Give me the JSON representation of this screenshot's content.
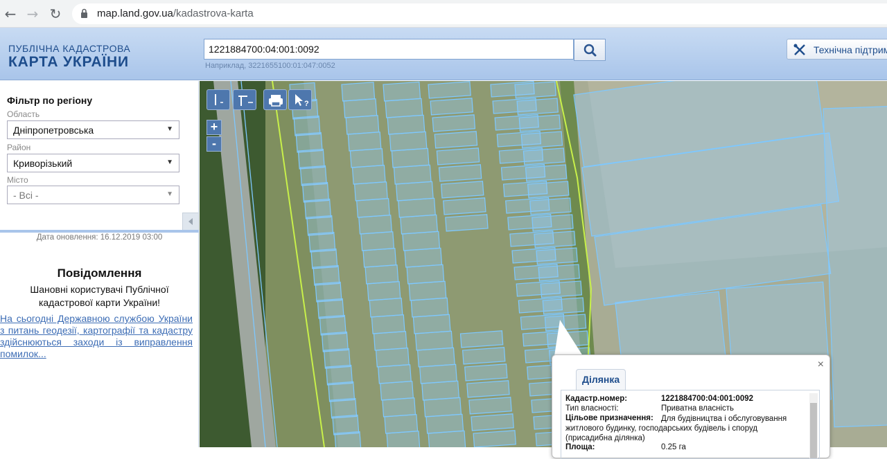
{
  "browser": {
    "url_host": "map.land.gov.ua",
    "url_path": "/kadastrova-karta",
    "back": "←",
    "forward": "→",
    "reload": "↻"
  },
  "header": {
    "logo_top": "ПУБЛІЧНА КАДАСТРОВА",
    "logo_bottom": "КАРТА УКРАЇНИ",
    "search_value": "1221884700:04:001:0092",
    "search_hint": "Наприклад, 3221655100:01:047:0052",
    "support_label": "Технічна підтримка"
  },
  "sidebar": {
    "filter_title": "Фільтр по регіону",
    "oblast_label": "Область",
    "oblast_value": "Дніпропетровська",
    "rayon_label": "Район",
    "rayon_value": "Криворізький",
    "misto_label": "Місто",
    "misto_value": "- Всі -",
    "update_date": "Дата оновлення: 16.12.2019 03:00",
    "notice_title": "Повідомлення",
    "notice_text": "Шановні користувачі Публічної кадастрової карти України!",
    "notice_link": "На сьогодні Державною службою України з питань геодезії, картографії та кадастру здійснюються заходи із виправлення помилок..."
  },
  "map": {
    "zoom_in": "+",
    "zoom_out": "-",
    "tools": [
      "measure-distance",
      "measure-area",
      "print",
      "identify"
    ]
  },
  "popup": {
    "tab_label": "Ділянка",
    "close": "×",
    "rows": [
      {
        "label": "Кадастр.номер:",
        "value": "1221884700:04:001:0092"
      },
      {
        "label": "Тип власності:",
        "value": "Приватна власність"
      },
      {
        "label": "Цільове призначення:",
        "value": "Для будівництва і обслуговування житлового будинку, господарських будівель і споруд (присадибна ділянка)"
      },
      {
        "label": "Площа:",
        "value": "0.25 га"
      }
    ]
  },
  "colors": {
    "header_blue": "#1e4d8c",
    "parcel_outline": "#7ec8ff",
    "boundary_line": "#c8f04a"
  }
}
